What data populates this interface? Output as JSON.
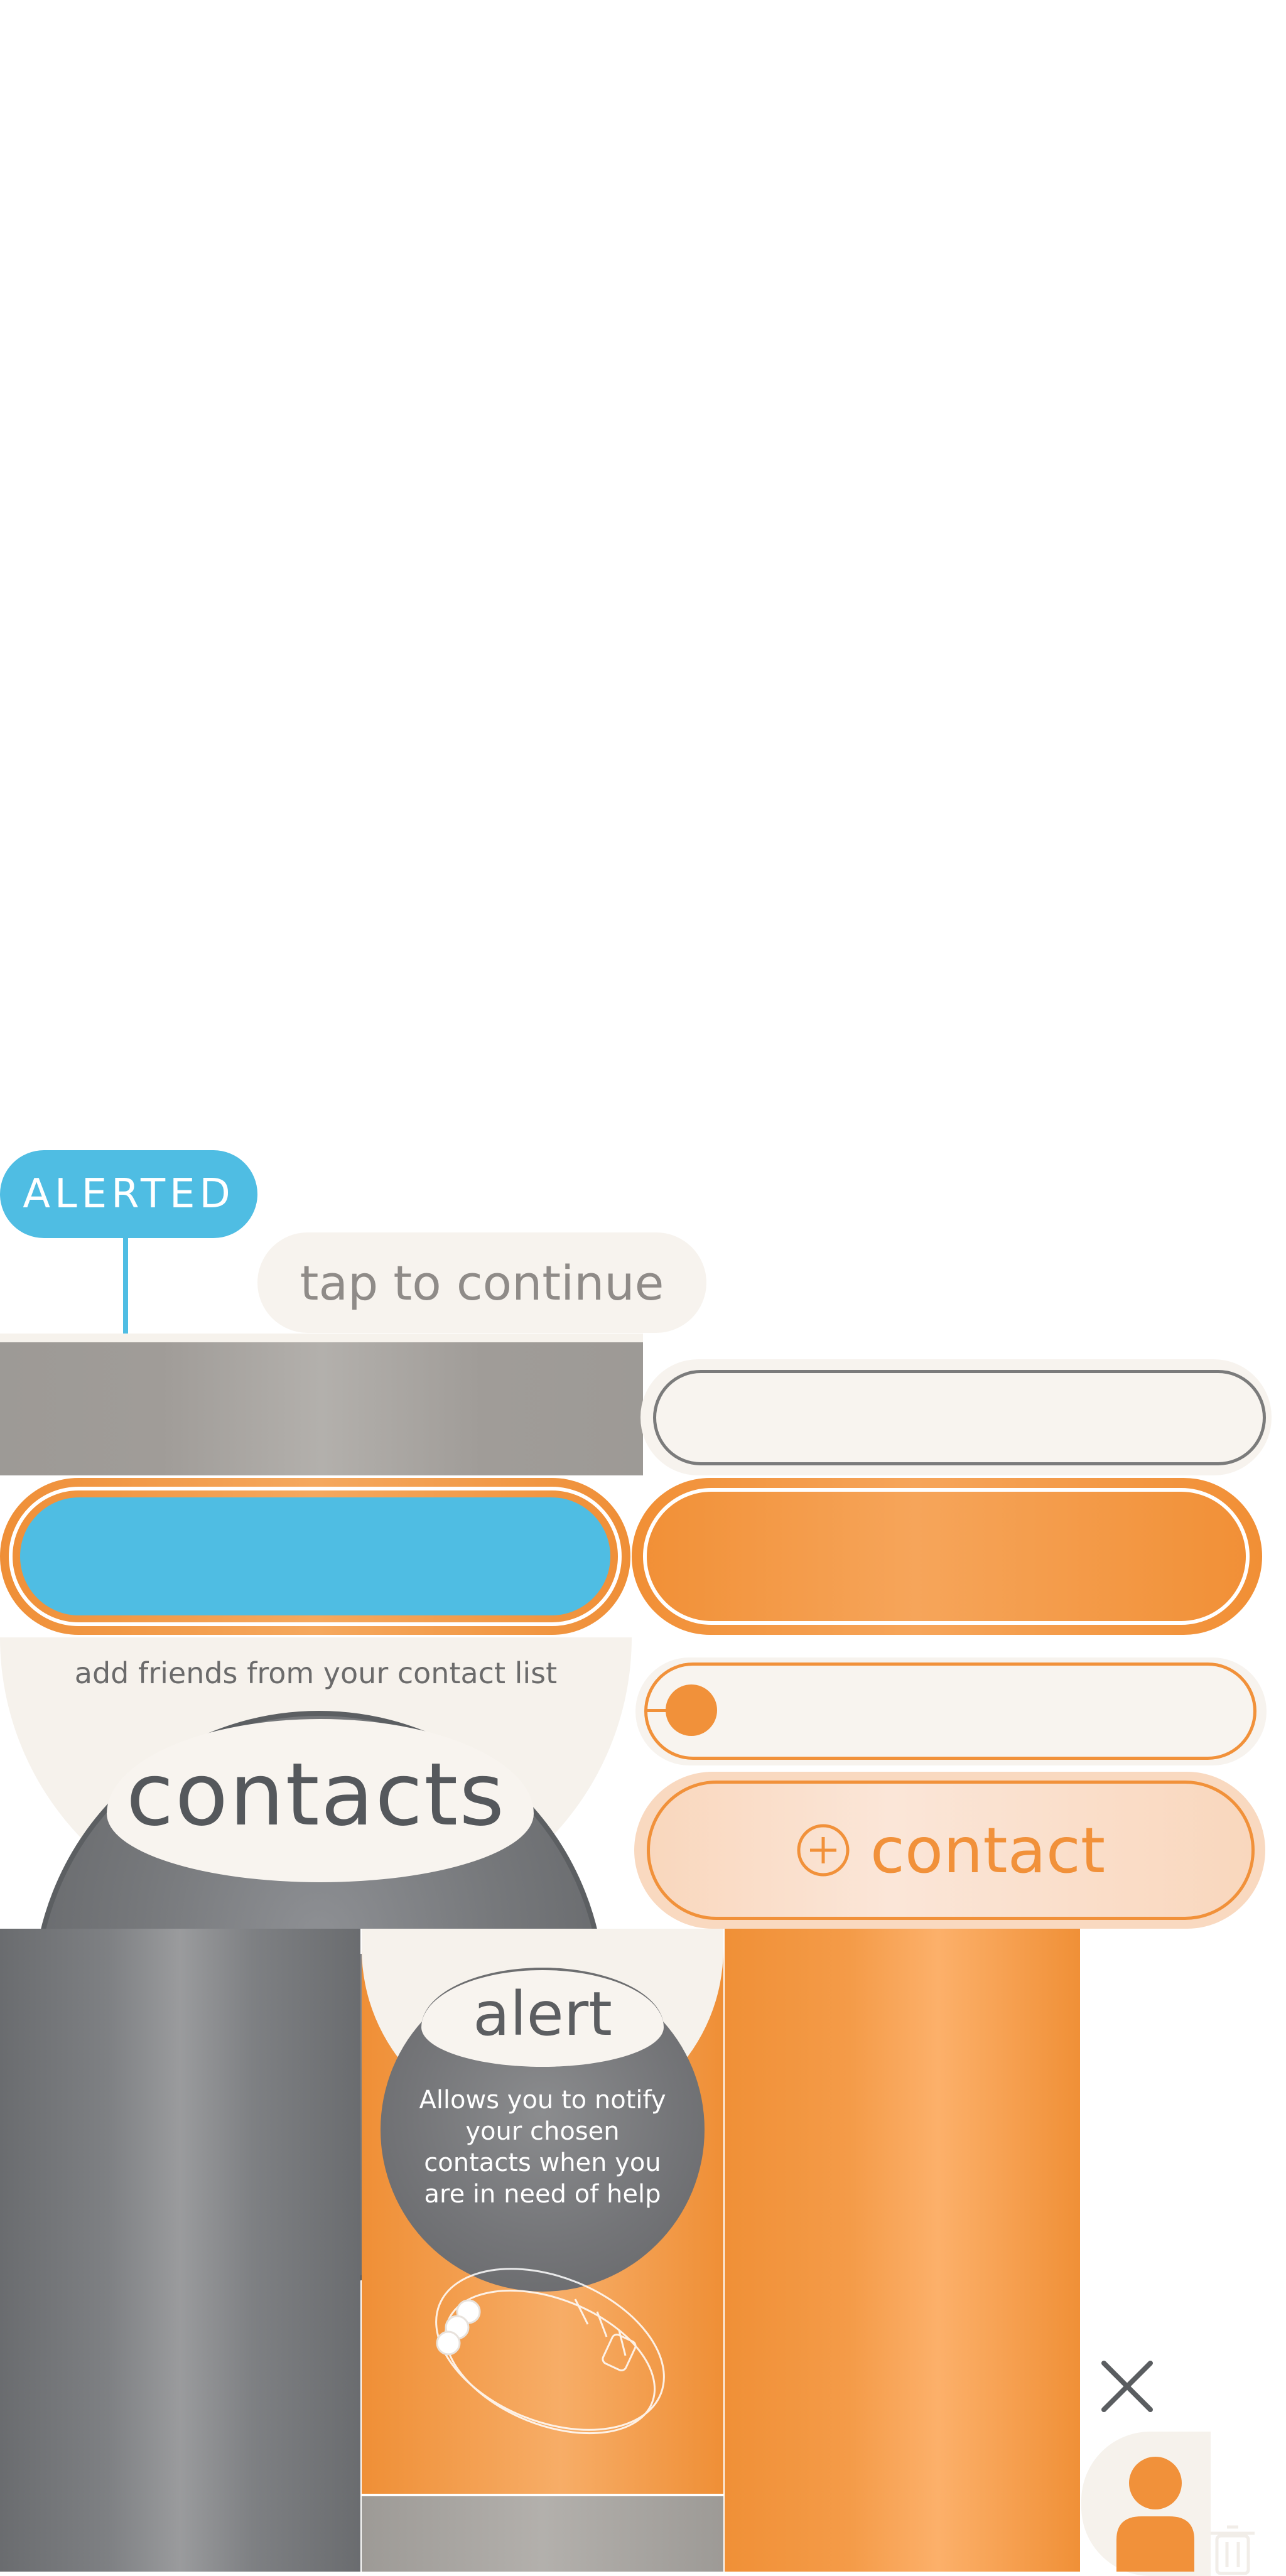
{
  "badge": {
    "label": "ALERTED"
  },
  "tap_prompt": {
    "label": "tap to continue"
  },
  "contacts": {
    "subtitle": "add friends from your contact list",
    "title": "contacts"
  },
  "add_contact": {
    "label": "contact",
    "icon": "plus-circle-icon"
  },
  "alert": {
    "title": "alert",
    "description": "Allows you to notify your chosen contacts when you are in need of help"
  },
  "icons": {
    "close": "close-icon",
    "avatar": "person-icon",
    "trash": "trash-icon",
    "bracelet": "bracelet-icon"
  },
  "colors": {
    "accent_blue": "#4fbde3",
    "accent_orange": "#f1913a",
    "cream": "#f6f2ec",
    "dark_gray": "#5c5f62"
  }
}
